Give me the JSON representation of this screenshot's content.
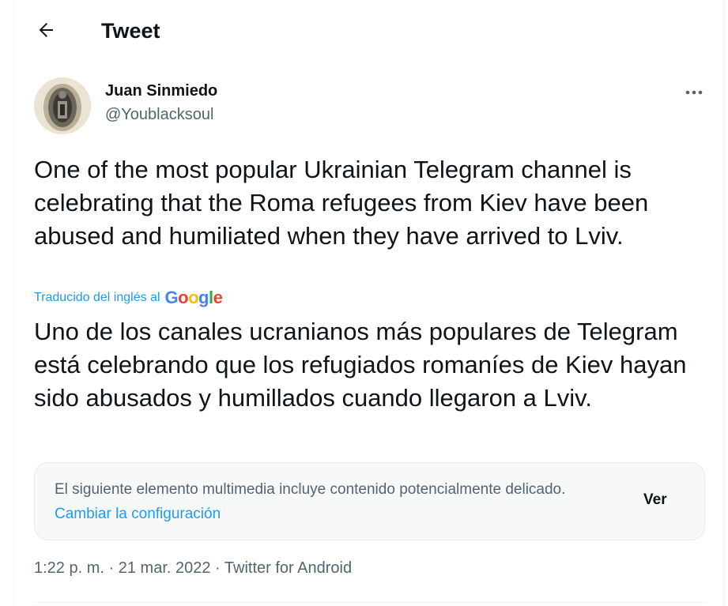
{
  "header": {
    "back_icon": "arrow-left-icon",
    "title": "Tweet"
  },
  "author": {
    "name": "Juan Sinmiedo",
    "handle": "@Youblacksoul",
    "avatar_icon": "avatar-image"
  },
  "more_icon": "more-dots-icon",
  "tweet": {
    "text": "One of the most popular Ukrainian Telegram channel is celebrating that the Roma refugees from Kiev have been abused and humiliated when they have arrived to Lviv.",
    "translated_by_label": "Traducido del inglés al",
    "translator_brand": "Google",
    "translated_text": "Uno de los canales ucranianos más populares de Telegram está celebrando que los refugiados romaníes de Kiev hayan sido abusados y humillados cuando llegaron a Lviv."
  },
  "sensitive_notice": {
    "message": "El siguiente elemento multimedia incluye contenido potencialmente delicado.",
    "link_label": "Cambiar la configuración",
    "view_label": "Ver"
  },
  "meta": {
    "time": "1:22 p. m.",
    "separator": "·",
    "date": "21 mar. 2022",
    "source": "Twitter for Android"
  },
  "colors": {
    "accent": "#1d9bf0",
    "text_primary": "#0f1419",
    "text_secondary": "#536471",
    "google_blue": "#4285f4",
    "google_red": "#ea4335",
    "google_yellow": "#fbbc05",
    "google_green": "#34a853"
  }
}
